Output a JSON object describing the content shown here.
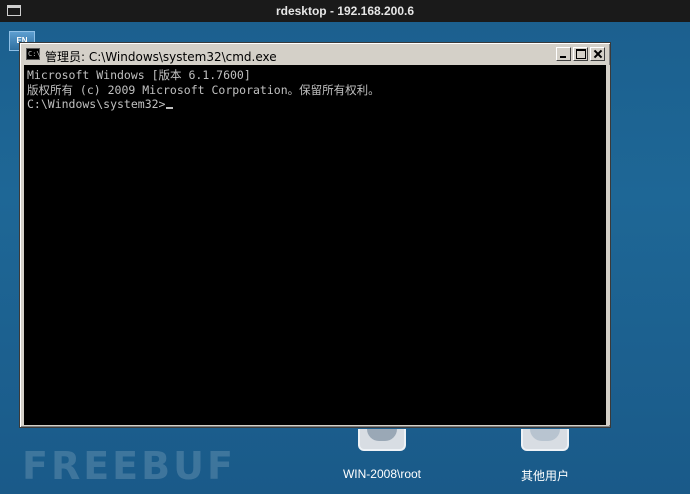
{
  "rdesktop": {
    "title": "rdesktop - 192.168.200.6"
  },
  "lang_indicator": {
    "label": "EN"
  },
  "cmd_window": {
    "title": "管理员: C:\\Windows\\system32\\cmd.exe",
    "icon_text": "C:\\",
    "console_lines": [
      "Microsoft Windows [版本 6.1.7600]",
      "版权所有 (c) 2009 Microsoft Corporation。保留所有权利。",
      "",
      "C:\\Windows\\system32>"
    ]
  },
  "user_tiles": [
    {
      "name": "WIN-2008\\root",
      "icon": "user-picture-icon"
    },
    {
      "name": "其他用户",
      "icon": "user-picture-icon"
    }
  ],
  "watermark": {
    "text": "FREEBUF"
  },
  "colors": {
    "console_bg": "#000000",
    "console_fg": "#c0c0c0",
    "desktop_bg": "#1e6796",
    "window_chrome": "#d4d0c8"
  }
}
